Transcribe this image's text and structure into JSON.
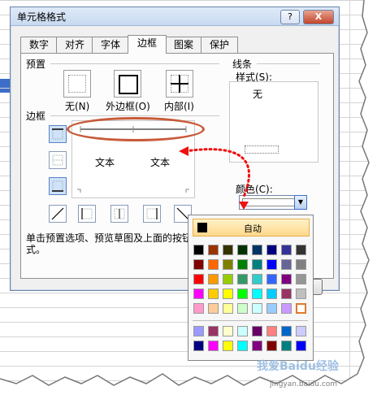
{
  "dialog": {
    "title": "单元格格式",
    "help_button": "?",
    "close_button": "X"
  },
  "tabs": [
    "数字",
    "对齐",
    "字体",
    "边框",
    "图案",
    "保护"
  ],
  "active_tab": "边框",
  "presets": {
    "group_label": "预置",
    "none_label": "无(N)",
    "outline_label": "外边框(O)",
    "inside_label": "内部(I)"
  },
  "border": {
    "group_label": "边框",
    "preview_text_left": "文本",
    "preview_text_right": "文本"
  },
  "line": {
    "group_label": "线条",
    "style_label": "样式(S):",
    "style_none": "无",
    "color_label": "颜色(C):"
  },
  "hint_text_line1": "单击预置选项、预览草图及上面的按钮",
  "hint_text_line2": "式。",
  "palette": {
    "auto_label": "自动",
    "rows": [
      [
        "#000000",
        "#993300",
        "#333300",
        "#003300",
        "#003366",
        "#000080",
        "#333399",
        "#333333"
      ],
      [
        "#800000",
        "#ff6600",
        "#808000",
        "#008000",
        "#008080",
        "#0000ff",
        "#666699",
        "#808080"
      ],
      [
        "#ff0000",
        "#ff9900",
        "#99cc00",
        "#339966",
        "#33cccc",
        "#3366ff",
        "#800080",
        "#969696"
      ],
      [
        "#ff00ff",
        "#ffcc00",
        "#ffff00",
        "#00ff00",
        "#00ffff",
        "#00ccff",
        "#993366",
        "#c0c0c0"
      ],
      [
        "#ff99cc",
        "#ffcc99",
        "#ffff99",
        "#ccffcc",
        "#ccffff",
        "#99ccff",
        "#cc99ff",
        "#ffffff"
      ]
    ],
    "extra_rows": [
      [
        "#9999ff",
        "#993366",
        "#ffffcc",
        "#ccffff",
        "#660066",
        "#ff8080",
        "#0066cc",
        "#ccccff"
      ],
      [
        "#000080",
        "#ff00ff",
        "#ffff00",
        "#00ffff",
        "#800080",
        "#800000",
        "#008080",
        "#0000ff"
      ]
    ],
    "selected": "#ffffff"
  },
  "watermark": {
    "brand": "我爱Baidu经验",
    "url": "jingyan.baidu.com"
  }
}
